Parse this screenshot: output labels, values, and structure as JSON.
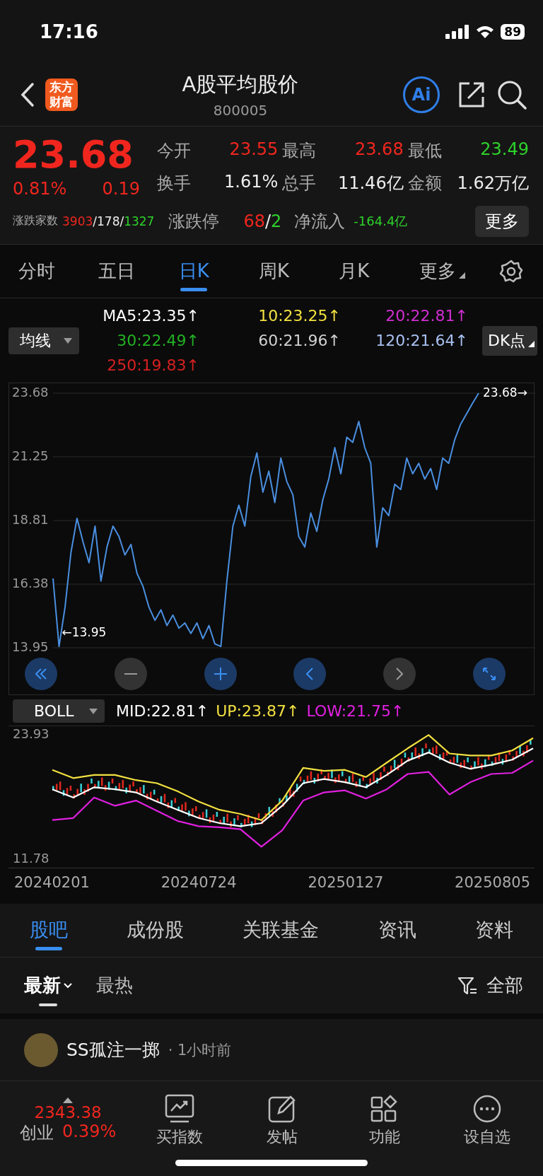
{
  "status_bar": {
    "time": "17:16",
    "battery": "89"
  },
  "header": {
    "logo": "东方财富",
    "title": "A股平均股价",
    "code": "800005",
    "ai_label": "Ai"
  },
  "quote": {
    "price": "23.68",
    "color": "#f0261e",
    "change_pct": "0.81%",
    "change": "0.19",
    "stats": [
      {
        "label": "今开",
        "value": "23.55",
        "color": "#f0261e"
      },
      {
        "label": "最高",
        "value": "23.68",
        "color": "#f0261e"
      },
      {
        "label": "最低",
        "value": "23.49",
        "color": "#2ed12a"
      },
      {
        "label": "换手",
        "value": "1.61%",
        "color": "#eeeeee"
      },
      {
        "label": "总手",
        "value": "11.46亿",
        "color": "#eeeeee"
      },
      {
        "label": "金额",
        "value": "1.62万亿",
        "color": "#eeeeee"
      }
    ],
    "breadth_label": "涨跌家数",
    "breadth": [
      {
        "text": "3903",
        "color": "#f0261e"
      },
      {
        "text": "/178/",
        "color": "#eeeeee"
      },
      {
        "text": "1327",
        "color": "#2ed12a"
      }
    ],
    "limit_label": "涨跌停",
    "limits": [
      {
        "text": "68",
        "color": "#f0261e"
      },
      {
        "text": "/",
        "color": "#eeeeee"
      },
      {
        "text": "2",
        "color": "#2ed12a"
      }
    ],
    "inflow_label": "净流入",
    "inflow": {
      "text": "-164.4亿",
      "color": "#2ed12a"
    },
    "more_button": "更多"
  },
  "tabs": [
    {
      "label": "分时",
      "selected": false
    },
    {
      "label": "五日",
      "selected": false
    },
    {
      "label": "日K",
      "selected": true
    },
    {
      "label": "周K",
      "selected": false
    },
    {
      "label": "月K",
      "selected": false
    },
    {
      "label": "更多",
      "selected": false
    }
  ],
  "indicator_bar": {
    "selector": "均线",
    "dk_button": "DK点",
    "ma": [
      {
        "text": "MA5:23.35↑",
        "color": "#ffffff"
      },
      {
        "text": "10:23.25↑",
        "color": "#f2e040"
      },
      {
        "text": "20:22.81↑",
        "color": "#d12ed1"
      },
      {
        "text": "30:22.49↑",
        "color": "#22b022"
      },
      {
        "text": "60:21.96↑",
        "color": "#d0d0d0"
      },
      {
        "text": "120:21.64↑",
        "color": "#a8c0f0"
      },
      {
        "text": "250:19.83↑",
        "color": "#d62020"
      }
    ]
  },
  "main_chart": {
    "high_label": "23.68→",
    "low_label": "←13.95",
    "chart_data": {
      "type": "line",
      "grid": true,
      "ylim": [
        13.95,
        23.68
      ],
      "yticks": [
        23.68,
        21.25,
        18.81,
        16.38,
        13.95
      ],
      "series": [
        {
          "color": "#4a8fe0",
          "values": [
            16.6,
            14.0,
            15.5,
            17.6,
            18.9,
            18.0,
            17.2,
            18.6,
            16.5,
            17.8,
            18.6,
            18.2,
            17.5,
            17.9,
            16.8,
            16.3,
            15.5,
            15.0,
            15.4,
            14.8,
            15.2,
            14.7,
            14.9,
            14.5,
            14.9,
            14.3,
            14.8,
            14.1,
            14.0,
            16.5,
            18.6,
            19.4,
            18.6,
            20.5,
            21.4,
            19.9,
            20.7,
            19.5,
            21.2,
            20.3,
            19.8,
            18.2,
            17.8,
            19.1,
            18.4,
            19.6,
            20.4,
            21.6,
            20.6,
            22.0,
            21.8,
            22.6,
            21.6,
            21.0,
            17.8,
            19.3,
            19.0,
            20.2,
            20.0,
            21.2,
            20.6,
            21.0,
            20.4,
            20.8,
            20.0,
            21.2,
            21.0,
            21.9,
            22.5,
            22.9,
            23.3,
            23.68
          ]
        }
      ]
    },
    "zoom_controls": [
      {
        "kind": "first",
        "disabled": false
      },
      {
        "kind": "minus",
        "disabled": true
      },
      {
        "kind": "plus",
        "disabled": false
      },
      {
        "kind": "prev",
        "disabled": false
      },
      {
        "kind": "next",
        "disabled": true
      },
      {
        "kind": "expand",
        "disabled": false
      }
    ]
  },
  "boll": {
    "selector": "BOLL",
    "readings": [
      {
        "text": "MID:22.81↑",
        "color": "#ffffff"
      },
      {
        "text": "UP:23.87↑",
        "color": "#f2e040"
      },
      {
        "text": "LOW:21.75↑",
        "color": "#e020e0"
      }
    ],
    "date_labels": [
      "20240201",
      "20240724",
      "20250127",
      "20250805"
    ],
    "chart_data": {
      "type": "line",
      "ylim": [
        11.78,
        23.93
      ],
      "yticks": [
        23.93,
        11.78
      ],
      "series": [
        {
          "color": "#f2e040",
          "values": [
            20.5,
            19.7,
            20.0,
            20.0,
            19.5,
            19.2,
            18.4,
            17.4,
            16.6,
            16.2,
            15.6,
            17.5,
            20.7,
            20.4,
            20.5,
            19.8,
            21.2,
            22.6,
            23.9,
            22.1,
            21.9,
            21.9,
            22.4,
            23.6
          ]
        },
        {
          "color": "#ffffff",
          "values": [
            18.6,
            17.8,
            18.8,
            18.6,
            18.3,
            17.4,
            16.6,
            15.8,
            15.3,
            15.0,
            15.3,
            17.0,
            19.2,
            19.6,
            19.3,
            18.8,
            20.0,
            21.4,
            22.2,
            21.2,
            20.6,
            21.0,
            21.5,
            22.6
          ]
        },
        {
          "color": "#e020e0",
          "values": [
            15.6,
            15.8,
            17.8,
            17.0,
            17.5,
            16.5,
            15.5,
            15.0,
            14.9,
            14.7,
            13.0,
            14.6,
            17.5,
            18.3,
            18.5,
            17.7,
            18.6,
            20.1,
            20.3,
            18.1,
            19.3,
            20.1,
            20.2,
            21.4
          ]
        }
      ]
    }
  },
  "section_tabs": [
    {
      "label": "股吧",
      "selected": true
    },
    {
      "label": "成份股",
      "selected": false
    },
    {
      "label": "关联基金",
      "selected": false
    },
    {
      "label": "资讯",
      "selected": false
    },
    {
      "label": "资料",
      "selected": false
    }
  ],
  "feed_filter": {
    "sorts": [
      {
        "label": "最新",
        "selected": true
      },
      {
        "label": "最热",
        "selected": false
      }
    ],
    "filter": "全部"
  },
  "post": {
    "author": "SS孤注一掷",
    "time": "· 1小时前"
  },
  "bottom_bar": {
    "index_value": "2343.38",
    "index_name": "创业",
    "index_change": "0.39%",
    "color": "#f0261e",
    "items": [
      {
        "kind": "chart",
        "label": "买指数"
      },
      {
        "kind": "edit",
        "label": "发帖"
      },
      {
        "kind": "apps",
        "label": "功能"
      },
      {
        "kind": "more",
        "label": "设自选"
      }
    ]
  }
}
